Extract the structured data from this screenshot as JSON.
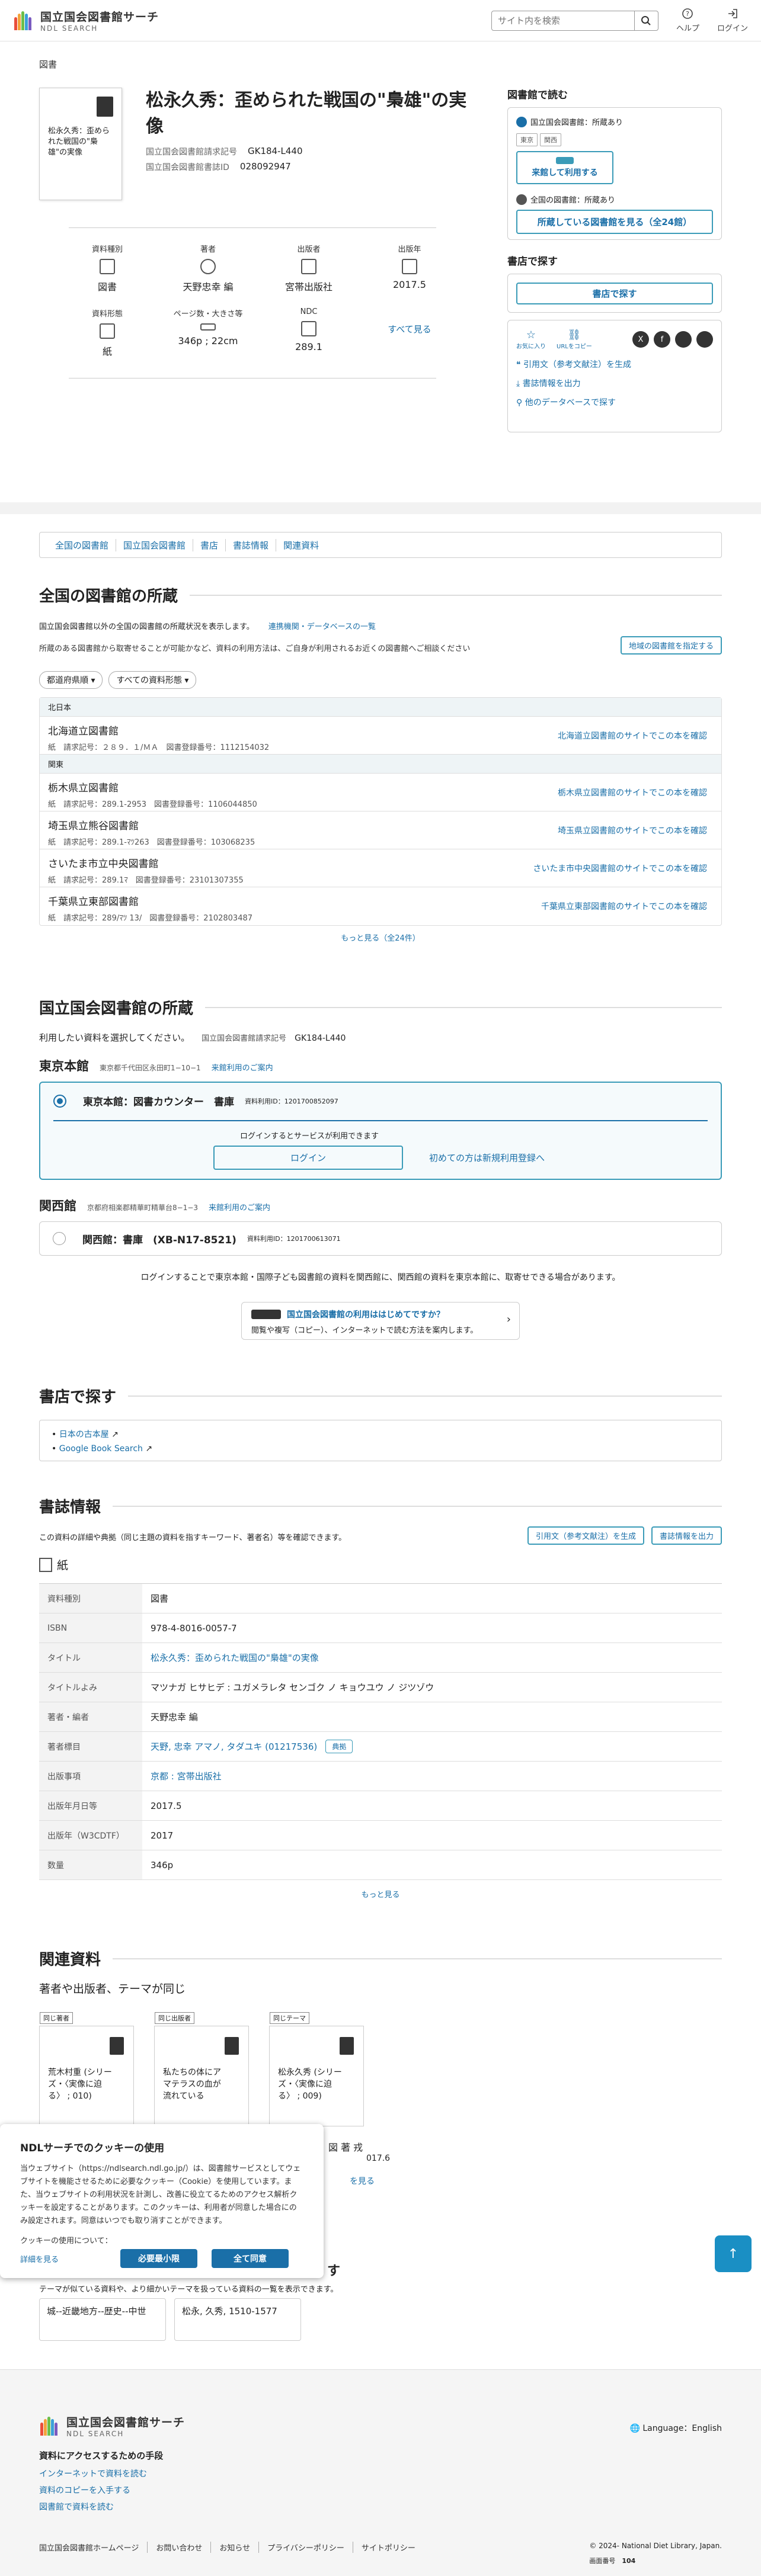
{
  "header": {
    "brand": "国立国会図書館サーチ",
    "brand_sub": "NDL SEARCH",
    "search_placeholder": "サイト内を検索",
    "help": "ヘルプ",
    "login": "ログイン"
  },
  "breadcrumb": "図書",
  "book": {
    "cover_title": "松永久秀：歪められた戦国の\"梟雄\"の実像",
    "title": "松永久秀：歪められた戦国の\"梟雄\"の実像",
    "callno_label": "国立国会図書館請求記号",
    "callno": "GK184-L440",
    "bibid_label": "国立国会図書館書誌ID",
    "bibid": "028092947"
  },
  "facets": [
    {
      "k": "資料種別",
      "v": "図書"
    },
    {
      "k": "著者",
      "v": "天野忠幸 編"
    },
    {
      "k": "出版者",
      "v": "宮帯出版社"
    },
    {
      "k": "出版年",
      "v": "2017.5"
    },
    {
      "k": "資料形態",
      "v": "紙"
    },
    {
      "k": "ページ数・大きさ等",
      "v": "346p ; 22cm"
    },
    {
      "k": "NDC",
      "v": "289.1"
    }
  ],
  "see_all": "すべて見る",
  "side": {
    "read_h": "図書館で読む",
    "ndl_label": "国立国会図書館：所蔵あり",
    "tag1": "東京",
    "tag2": "関西",
    "visit_btn": "来館して利用する",
    "all_label": "全国の図書館：所蔵あり",
    "libs_btn": "所蔵している図書館を見る（全24館）",
    "shop_h": "書店で探す",
    "shop_btn": "書店で探す",
    "fav": "お気に入り",
    "url": "URLをコピー",
    "cite": "引用文（参考文献注）を生成",
    "export": "書誌情報を出力",
    "other_db": "他のデータベースで探す"
  },
  "tabs": [
    "全国の図書館",
    "国立国会図書館",
    "書店",
    "書誌情報",
    "関連資料"
  ],
  "nat": {
    "h": "全国の図書館の所蔵",
    "p1": "国立国会図書館以外の全国の図書館の所蔵状況を表示します。",
    "p1_link": "連携機関・データベースの一覧",
    "p2": "所蔵のある図書館から取寄せることが可能かなど、資料の利用方法は、ご自身が利用されるお近くの図書館へご相談ください",
    "region_btn": "地域の図書館を指定する",
    "dd1": "都道府県順",
    "dd2": "すべての資料形態",
    "regions": [
      {
        "name": "北日本",
        "libs": [
          {
            "n": "北海道立図書館",
            "t": "紙",
            "cn": "請求記号：２８９．１/ＭＡ",
            "id": "図書登録番号：1112154032",
            "link": "北海道立図書館のサイトでこの本を確認"
          }
        ]
      },
      {
        "name": "関東",
        "libs": [
          {
            "n": "栃木県立図書館",
            "t": "紙",
            "cn": "請求記号：289.1-2953",
            "id": "図書登録番号：1106044850",
            "link": "栃木県立図書館のサイトでこの本を確認"
          },
          {
            "n": "埼玉県立熊谷図書館",
            "t": "紙",
            "cn": "請求記号：289.1-ﾏﾂ263",
            "id": "図書登録番号：103068235",
            "link": "埼玉県立図書館のサイトでこの本を確認"
          },
          {
            "n": "さいたま市立中央図書館",
            "t": "紙",
            "cn": "請求記号：289.1ﾏ",
            "id": "図書登録番号：23101307355",
            "link": "さいたま市中央図書館のサイトでこの本を確認"
          },
          {
            "n": "千葉県立東部図書館",
            "t": "紙",
            "cn": "請求記号：289/ﾏﾂ 13/",
            "id": "図書登録番号：2102803487",
            "link": "千葉県立東部図書館のサイトでこの本を確認"
          }
        ]
      }
    ],
    "more": "もっと見る（全24件）"
  },
  "ndl": {
    "h": "国立国会図書館の所蔵",
    "choose": "利用したい資料を選択してください。",
    "cn_label": "国立国会図書館請求記号",
    "cn": "GK184-L440",
    "tokyo": {
      "name": "東京本館",
      "addr": "東京都千代田区永田町1−10−1",
      "guide": "来館利用のご案内",
      "item": "東京本館：図書カウンター　書庫",
      "id": "資料利用ID：1201700852097",
      "login_msg": "ログインするとサービスが利用できます",
      "login_btn": "ログイン",
      "register": "初めての方は新規利用登録へ"
    },
    "kansai": {
      "name": "関西館",
      "addr": "京都府相楽郡精華町精華台8−1−3",
      "guide": "来館利用のご案内",
      "item": "関西館：書庫　(XB-N17-8521)",
      "id": "資料利用ID：1201700613071"
    },
    "note": "ログインすることで東京本館・国際子ども図書館の資料を関西館に、関西館の資料を東京本館に、取寄せできる場合があります。",
    "first_title": "国立国会図書館の利用ははじめてですか？",
    "first_sub": "閲覧や複写（コピー）、インターネットで読む方法を案内します。"
  },
  "shop": {
    "h": "書店で探す",
    "l1": "日本の古本屋",
    "l2": "Google Book Search"
  },
  "biblio": {
    "h": "書誌情報",
    "p": "この資料の詳細や典拠（同じ主題の資料を指すキーワード、著者名）等を確認できます。",
    "cite": "引用文（参考文献注）を生成",
    "export": "書誌情報を出力",
    "form": "紙",
    "rows": [
      {
        "k": "資料種別",
        "v": "図書"
      },
      {
        "k": "ISBN",
        "v": "978-4-8016-0057-7"
      },
      {
        "k": "タイトル",
        "v": "松永久秀：歪められた戦国の\"梟雄\"の実像"
      },
      {
        "k": "タイトルよみ",
        "v": "マツナガ ヒサヒデ : ユガメラレタ センゴク ノ キョウユウ ノ ジツゾウ"
      },
      {
        "k": "著者・編者",
        "v": "天野忠幸 編"
      },
      {
        "k": "著者標目",
        "v": "天野, 忠幸 アマノ, タダユキ (01217536)",
        "extra": "典拠"
      },
      {
        "k": "出版事項",
        "v": "京都 : 宮帯出版社"
      },
      {
        "k": "出版年月日等",
        "v": "2017.5"
      },
      {
        "k": "出版年（W3CDTF）",
        "v": "2017"
      },
      {
        "k": "数量",
        "v": "346p"
      }
    ],
    "more": "もっと見る"
  },
  "related": {
    "h": "関連資料",
    "sub": "著者や出版者、テーマが同じ",
    "items": [
      {
        "lab": "同じ著者",
        "t": "荒木村重 (シリーズ・〈実像に迫る〉 ; 010)"
      },
      {
        "lab": "同じ出版者",
        "t": "私たちの体にアマテラスの血が流れている"
      },
      {
        "lab": "同じテーマ",
        "t": "松永久秀 (シリーズ・〈実像に迫る〉 ; 009)"
      }
    ],
    "frag1": "図 著 戎",
    "frag2": "017.6",
    "frag3": "を見る",
    "theme_sub": "テーマが似ている資料や、より細かいテーマを扱っている資料の一覧を表示できます。",
    "t1": "城--近畿地方--歴史--中世",
    "t2": "松永, 久秀, 1510-1577",
    "theme_frag": "す"
  },
  "cookie": {
    "h": "NDLサーチでのクッキーの使用",
    "p": "当ウェブサイト（https://ndlsearch.ndl.go.jp/）は、図書館サービスとしてウェブサイトを機能させるために必要なクッキー（Cookie）を使用しています。また、当ウェブサイトの利用状況を計測し、改善に役立てるためのアクセス解析クッキーを設定することがあります。このクッキーは、利用者が同意した場合にのみ設定されます。同意はいつでも取り消すことができます。",
    "q": "クッキーの使用について：",
    "more": "詳細を見る",
    "need": "必要最小限",
    "all": "全て同意"
  },
  "footer": {
    "brand": "国立国会図書館サーチ",
    "brand_sub": "NDL SEARCH",
    "lang": "Language：English",
    "access_h": "資料にアクセスするための手段",
    "l1": "インターネットで資料を読む",
    "l2": "資料のコピーを入手する",
    "l3": "図書館で資料を読む",
    "links": [
      "国立国会図書館ホームページ",
      "お問い合わせ",
      "お知らせ",
      "プライバシーポリシー",
      "サイトポリシー"
    ],
    "copy": "© 2024- National Diet Library, Japan.",
    "page_no_label": "画面番号",
    "page_no": "104"
  },
  "colors": {
    "accent": "#1a6fa8",
    "border": "#3a9bb8",
    "top_btn": "#1a8fc4"
  }
}
